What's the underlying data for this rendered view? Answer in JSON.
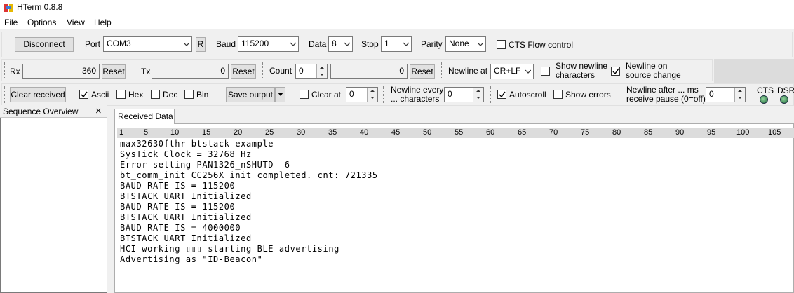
{
  "window": {
    "title": "HTerm 0.8.8"
  },
  "menu": [
    "File",
    "Options",
    "View",
    "Help"
  ],
  "connection": {
    "disconnect_label": "Disconnect",
    "port_label": "Port",
    "port_value": "COM3",
    "refresh_label": "R",
    "baud_label": "Baud",
    "baud_value": "115200",
    "data_label": "Data",
    "data_value": "8",
    "stop_label": "Stop",
    "stop_value": "1",
    "parity_label": "Parity",
    "parity_value": "None",
    "cts_flow_label": "CTS Flow control",
    "cts_flow_checked": false
  },
  "counters": {
    "rx_label": "Rx",
    "rx_value": "360",
    "rx_reset": "Reset",
    "tx_label": "Tx",
    "tx_value": "0",
    "tx_reset": "Reset",
    "count_label": "Count",
    "count_value": "0",
    "count_display": "0",
    "count_reset": "Reset",
    "newline_at_label": "Newline at",
    "newline_at_value": "CR+LF",
    "show_newline_line1": "Show newline",
    "show_newline_line2": "characters",
    "show_newline_checked": false,
    "newline_source_line1": "Newline on",
    "newline_source_line2": "source change",
    "newline_source_checked": true
  },
  "display": {
    "clear_received": "Clear received",
    "ascii_label": "Ascii",
    "ascii_checked": true,
    "hex_label": "Hex",
    "hex_checked": false,
    "dec_label": "Dec",
    "dec_checked": false,
    "bin_label": "Bin",
    "bin_checked": false,
    "save_output": "Save output",
    "clear_at_label": "Clear at",
    "clear_at_checked": false,
    "clear_at_value": "0",
    "newline_every_line1": "Newline every",
    "newline_every_line2": "... characters",
    "newline_every_value": "0",
    "autoscroll_label": "Autoscroll",
    "autoscroll_checked": true,
    "show_errors_label": "Show errors",
    "show_errors_checked": false,
    "newline_after_line1": "Newline after ... ms",
    "newline_after_line2": "receive pause (0=off)",
    "newline_after_value": "0",
    "cts_label": "CTS",
    "dsr_label": "DSR"
  },
  "sequence_panel": {
    "title": "Sequence Overview",
    "close": "×"
  },
  "received": {
    "tab_label": "Received Data",
    "ruler": [
      "1",
      "5",
      "10",
      "15",
      "20",
      "25",
      "30",
      "35",
      "40",
      "45",
      "50",
      "55",
      "60",
      "65",
      "70",
      "75",
      "80",
      "85",
      "90",
      "95",
      "100",
      "105"
    ],
    "lines": [
      "max32630fthr btstack example",
      "SysTick Clock = 32768 Hz",
      "Error setting PAN1326_nSHUTD -6",
      "bt_comm_init CC256X init completed. cnt: 721335",
      "BAUD RATE IS = 115200",
      "BTSTACK UART Initialized",
      "BAUD RATE IS = 115200",
      "BTSTACK UART Initialized",
      "BAUD RATE IS = 4000000",
      "BTSTACK UART Initialized",
      "HCI working ▯▯▯ starting BLE advertising",
      "Advertising as \"ID-Beacon\""
    ]
  }
}
